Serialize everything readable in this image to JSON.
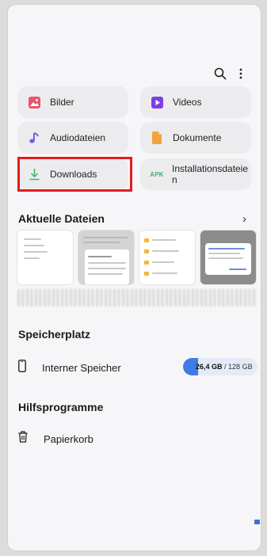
{
  "categories": {
    "images_label": "Bilder",
    "videos_label": "Videos",
    "audio_label": "Audiodateien",
    "documents_label": "Dokumente",
    "downloads_label": "Downloads",
    "installers_label": "Installationsdateie\nn",
    "installers_badge": "APK"
  },
  "recent": {
    "title": "Aktuelle Dateien",
    "chevron": "›"
  },
  "storage": {
    "title": "Speicherplatz",
    "internal_label": "Interner Speicher",
    "used": "26,4 GB",
    "total": "/ 128 GB",
    "used_fraction": 0.206
  },
  "tools": {
    "title": "Hilfsprogramme",
    "trash_label": "Papierkorb"
  },
  "colors": {
    "images_icon": "#e8546a",
    "videos_icon": "#7b3fe4",
    "audio_icon": "#7b5be0",
    "documents_icon": "#f3a33a",
    "downloads_icon": "#3db36b",
    "apk_text": "#3db36b",
    "highlight": "#e11d1d",
    "storage_fill": "#3f7be8"
  }
}
